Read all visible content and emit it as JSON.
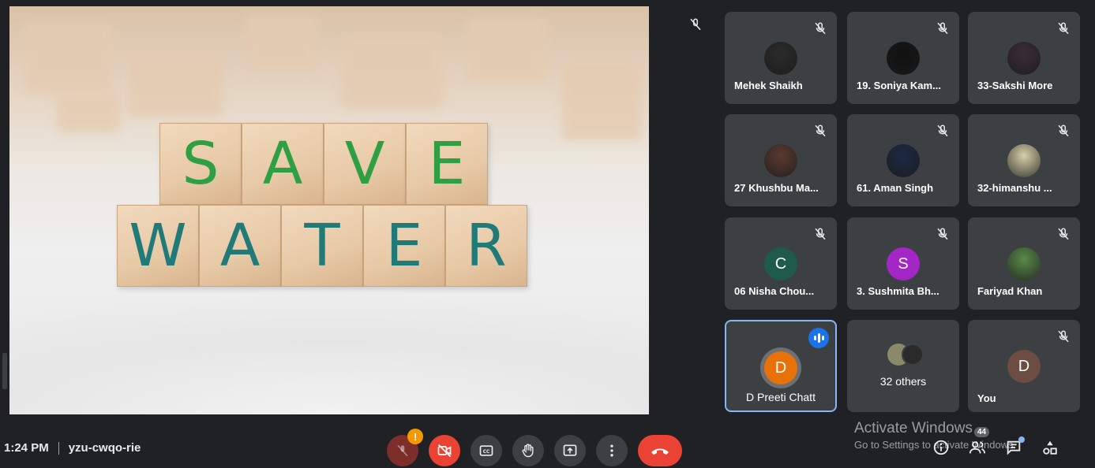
{
  "meeting": {
    "time": "1:24 PM",
    "code": "yzu-cwqo-rie"
  },
  "presentation": {
    "row1_letters": [
      "S",
      "A",
      "V",
      "E"
    ],
    "row2_letters": [
      "W",
      "A",
      "T",
      "E",
      "R"
    ]
  },
  "participants": [
    {
      "name": "Mehek Shaikh",
      "avatar": "photo",
      "color": "#2b2b2b",
      "muted": true
    },
    {
      "name": "19. Soniya Kam...",
      "avatar": "photo",
      "color": "#111111",
      "muted": true
    },
    {
      "name": "33-Sakshi More",
      "avatar": "photo",
      "color": "#3a2c3a",
      "muted": true
    },
    {
      "name": "27 Khushbu Ma...",
      "avatar": "photo",
      "color": "#5a3a30",
      "muted": true
    },
    {
      "name": "61. Aman Singh",
      "avatar": "photo",
      "color": "#1d2a44",
      "muted": true
    },
    {
      "name": "32-himanshu ...",
      "avatar": "photo",
      "color": "#d7d0a8",
      "muted": true
    },
    {
      "name": "06 Nisha Chou...",
      "avatar": "C",
      "color": "#1e5b49",
      "muted": true
    },
    {
      "name": "3. Sushmita Bh...",
      "avatar": "S",
      "color": "#a526c7",
      "muted": true
    },
    {
      "name": "Fariyad Khan",
      "avatar": "photo",
      "color": "#5b8a4a",
      "muted": true
    },
    {
      "name": "D Preeti Chatt",
      "avatar": "D",
      "color": "#e8710a",
      "muted": false,
      "speaking": true
    },
    {
      "name": "32 others",
      "avatar": "group",
      "color": "#6b6b5a",
      "muted": false
    },
    {
      "name": "You",
      "avatar": "D",
      "color": "#6d4c41",
      "muted": true
    }
  ],
  "controls": {
    "mic_warning": "!",
    "people_count": "44"
  },
  "watermark": {
    "line1": "Activate Windows",
    "line2": "Go to Settings to activate Windows."
  },
  "icons": [
    "mic-off-icon",
    "camera-off-icon",
    "captions-icon",
    "raise-hand-icon",
    "present-icon",
    "more-icon",
    "hangup-icon",
    "info-icon",
    "people-icon",
    "chat-icon",
    "activities-icon"
  ]
}
